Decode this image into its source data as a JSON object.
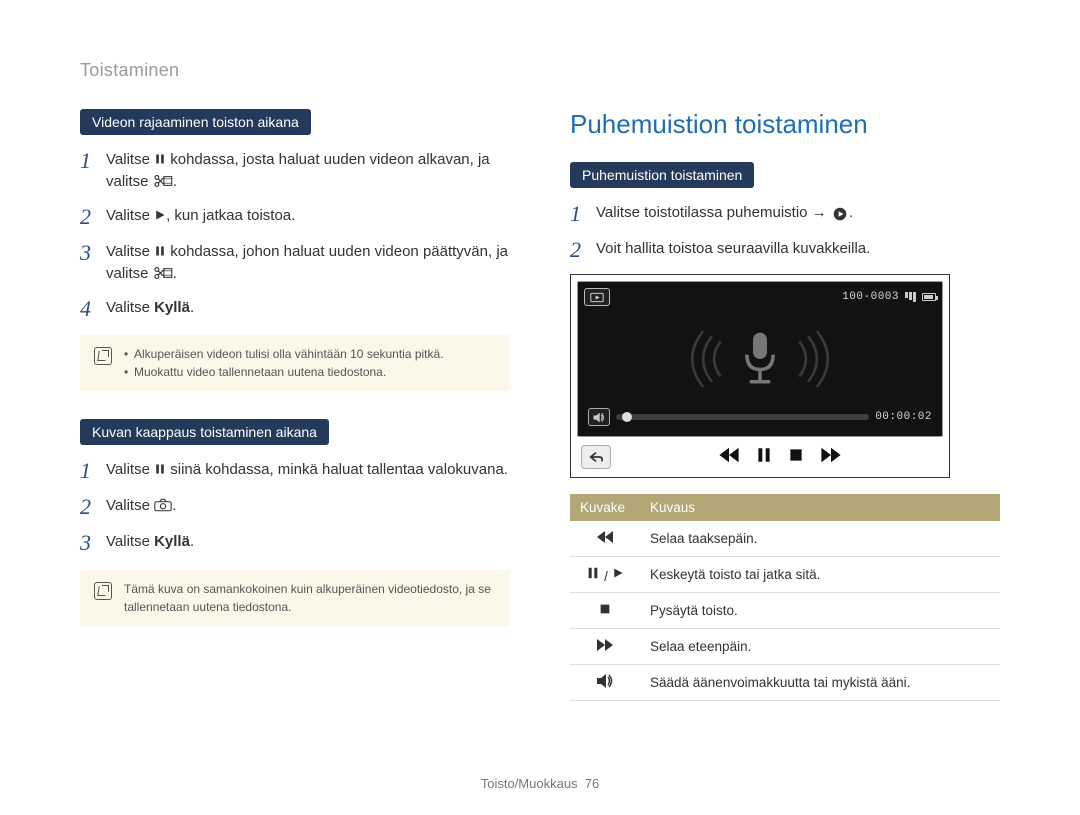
{
  "page_header": "Toistaminen",
  "left": {
    "section1": {
      "badge": "Videon rajaaminen toiston aikana",
      "steps": {
        "s1_a": "Valitse ",
        "s1_b": " kohdassa, josta haluat uuden videon alkavan, ja valitse ",
        "s1_c": ".",
        "s2_a": "Valitse ",
        "s2_b": ", kun jatkaa toistoa.",
        "s3_a": "Valitse ",
        "s3_b": " kohdassa, johon haluat uuden videon päättyvän, ja valitse ",
        "s3_c": ".",
        "s4_a": "Valitse ",
        "s4_bold": "Kyllä",
        "s4_b": "."
      },
      "notes": {
        "n1": "Alkuperäisen videon tulisi olla vähintään 10 sekuntia pitkä.",
        "n2": "Muokattu video tallennetaan uutena tiedostona."
      }
    },
    "section2": {
      "badge": "Kuvan kaappaus toistaminen aikana",
      "steps": {
        "s1_a": "Valitse ",
        "s1_b": " siinä kohdassa, minkä haluat tallentaa valokuvana.",
        "s2_a": "Valitse ",
        "s2_b": ".",
        "s3_a": "Valitse ",
        "s3_bold": "Kyllä",
        "s3_b": "."
      },
      "note": "Tämä kuva on samankokoinen kuin alkuperäinen videotiedosto, ja se tallennetaan uutena tiedostona."
    }
  },
  "right": {
    "heading": "Puhemuistion toistaminen",
    "badge": "Puhemuistion toistaminen",
    "steps": {
      "s1_a": "Valitse toistotilassa puhemuistio → ",
      "s1_b": ".",
      "s2": "Voit hallita toistoa seuraavilla kuvakkeilla."
    },
    "device": {
      "file_label": "100-0003",
      "time": "00:00:02"
    },
    "table": {
      "th1": "Kuvake",
      "th2": "Kuvaus",
      "rows": {
        "r1": "Selaa taaksepäin.",
        "r2": "Keskeytä toisto tai jatka sitä.",
        "r3": "Pysäytä toisto.",
        "r4": "Selaa eteenpäin.",
        "r5": "Säädä äänenvoimakkuutta tai mykistä ääni."
      }
    }
  },
  "footer": {
    "section": "Toisto/Muokkaus",
    "page": "76"
  }
}
